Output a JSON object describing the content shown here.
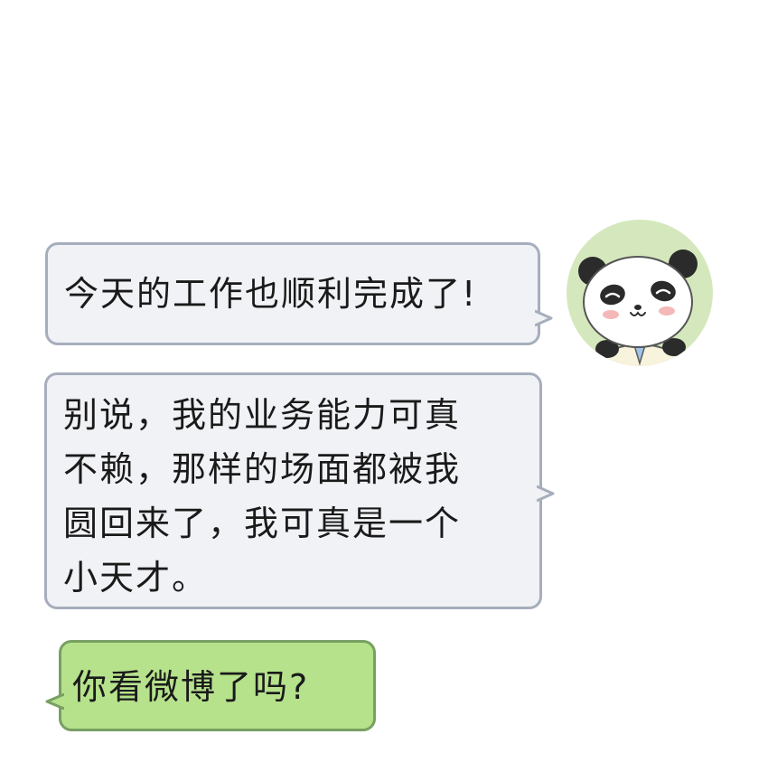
{
  "messages": [
    {
      "side": "right",
      "style": "gray",
      "text": "今天的工作也顺利完成了!"
    },
    {
      "side": "right",
      "style": "gray",
      "lines": [
        "别说，我的业务能力可真",
        "不赖，那样的场面都被我",
        "圆回来了，我可真是一个",
        "小天才。"
      ]
    },
    {
      "side": "left",
      "style": "green",
      "text": "你看微博了吗?"
    }
  ],
  "avatar": {
    "icon": "panda-avatar-icon"
  },
  "colors": {
    "gray_bubble": "#f1f2f5",
    "gray_border": "#a6aebd",
    "green_bubble": "#b6e28c",
    "green_border": "#78a062",
    "avatar_bg": "#d5e8bd"
  }
}
